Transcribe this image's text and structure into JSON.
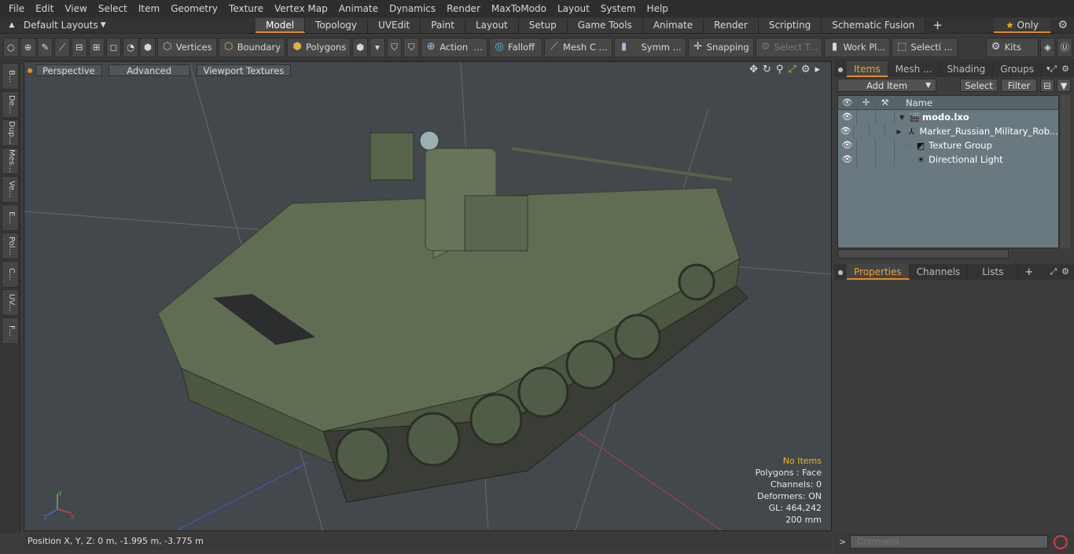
{
  "menu": [
    "File",
    "Edit",
    "View",
    "Select",
    "Item",
    "Geometry",
    "Texture",
    "Vertex Map",
    "Animate",
    "Dynamics",
    "Render",
    "MaxToModo",
    "Layout",
    "System",
    "Help"
  ],
  "layouts_label": "Default Layouts",
  "mode_tabs": [
    "Model",
    "Topology",
    "UVEdit",
    "Paint",
    "Layout",
    "Setup",
    "Game Tools",
    "Animate",
    "Render",
    "Scripting",
    "Schematic Fusion"
  ],
  "only_label": "Only",
  "toolbar": {
    "vertices": "Vertices",
    "boundary": "Boundary",
    "polygons": "Polygons",
    "action": "Action",
    "falloff": "Falloff",
    "mesh": "Mesh C ...",
    "symm": "Symm ...",
    "snapping": "Snapping",
    "select_t": "Select T...",
    "work_plane": "Work Pl...",
    "selecti": "Selecti ...",
    "kits": "Kits"
  },
  "sidebar_tabs": [
    "B...",
    "De...",
    "Dup...",
    "Mes...",
    "Ve...",
    "E...",
    "Pol...",
    "C...",
    "UV...",
    "F..."
  ],
  "viewport": {
    "perspective": "Perspective",
    "advanced": "Advanced",
    "viewport_textures": "Viewport Textures",
    "info": {
      "no_items": "No Items",
      "polygons": "Polygons : Face",
      "channels": "Channels: 0",
      "deformers": "Deformers: ON",
      "gl": "GL: 464,242",
      "scale": "200 mm"
    }
  },
  "status": "Position X, Y, Z:   0 m, -1.995 m, -3.775 m",
  "items_panel": {
    "tabs": [
      "Items",
      "Mesh ...",
      "Shading",
      "Groups"
    ],
    "add_item": "Add Item",
    "select": "Select",
    "filter": "Filter",
    "name_header": "Name",
    "rows": [
      "modo.lxo",
      "Marker_Russian_Military_Rob...",
      "Texture Group",
      "Directional Light"
    ]
  },
  "props_panel": {
    "tabs": [
      "Properties",
      "Channels",
      "Lists"
    ]
  },
  "command_placeholder": "Command",
  "accent_color": "#e88a1a"
}
